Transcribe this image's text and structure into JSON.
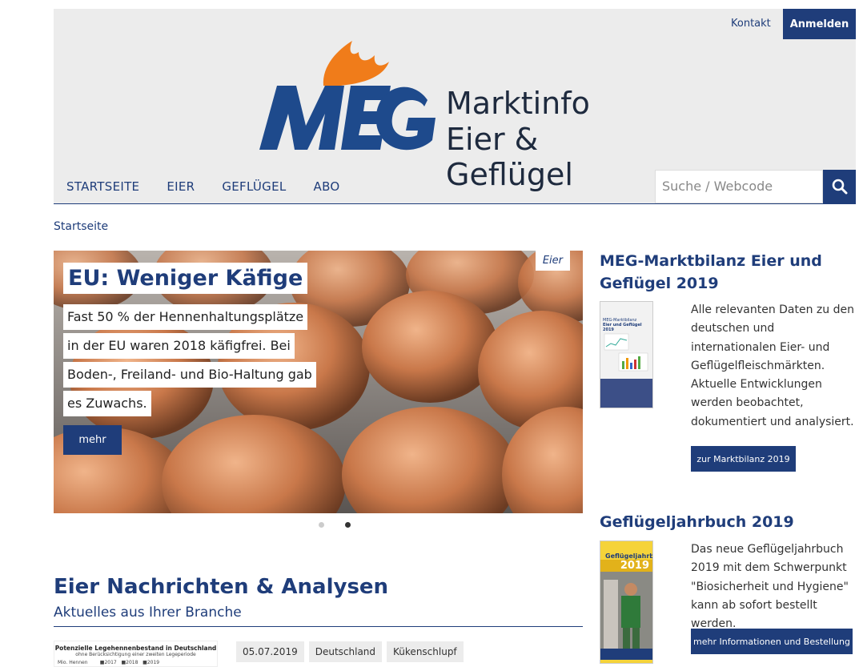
{
  "header": {
    "kontakt": "Kontakt",
    "anmelden": "Anmelden",
    "logo_brand": "MEG",
    "logo_line1": "Marktinfo",
    "logo_line2": "Eier & Geflügel"
  },
  "nav": {
    "items": [
      "STARTSEITE",
      "EIER",
      "GEFLÜGEL",
      "ABO"
    ],
    "search_placeholder": "Suche / Webcode"
  },
  "breadcrumb": "Startseite",
  "hero": {
    "tag": "Eier",
    "title": "EU: Weniger Käfige",
    "lines": [
      "Fast 50 % der Hennenhaltungsplätze",
      "in der EU waren 2018 käfigfrei. Bei",
      "Boden-, Freiland- und Bio-Haltung gab",
      "es Zuwachs."
    ],
    "button": "mehr",
    "slides_total": 2,
    "active_slide": 2
  },
  "news_section": {
    "title": "Eier Nachrichten & Analysen",
    "subtitle": "Aktuelles aus Ihrer Branche",
    "first_item": {
      "thumb_title": "Potenzielle Legehennenbestand in Deutschland",
      "thumb_subtitle": "ohne Berücksichtigung einer zweiten Legeperiode",
      "thumb_axis": "Mio. Hennen",
      "thumb_legend": [
        "■2017",
        "■2018",
        "■2019"
      ],
      "tags": [
        "05.07.2019",
        "Deutschland",
        "Kükenschlupf"
      ]
    }
  },
  "sidebar": {
    "block1": {
      "title": "MEG-Marktbilanz Eier und Geflügel 2019",
      "text": "Alle relevanten Daten zu den deutschen und internationalen Eier- und Geflügelfleischmärkten. Aktuelle Entwicklungen werden beobachtet, dokumentiert und analysiert.",
      "button": "zur Marktbilanz 2019",
      "book_label1": "MEG-Marktbilanz",
      "book_label2": "Eier und Geflügel 2019"
    },
    "block2": {
      "title": "Geflügeljahrbuch 2019",
      "text": "Das neue Geflügeljahrbuch 2019 mit dem Schwerpunkt \"Biosicherheit und Hygiene\" kann ab sofort bestellt werden.",
      "button": "mehr Informationen und Bestellung",
      "book_label1": "Geflügeljahrbuch",
      "book_label2": "2019"
    }
  },
  "colors": {
    "brand_blue": "#1f3d7a",
    "flame_orange": "#f07c1a",
    "header_bg": "#ececec"
  }
}
